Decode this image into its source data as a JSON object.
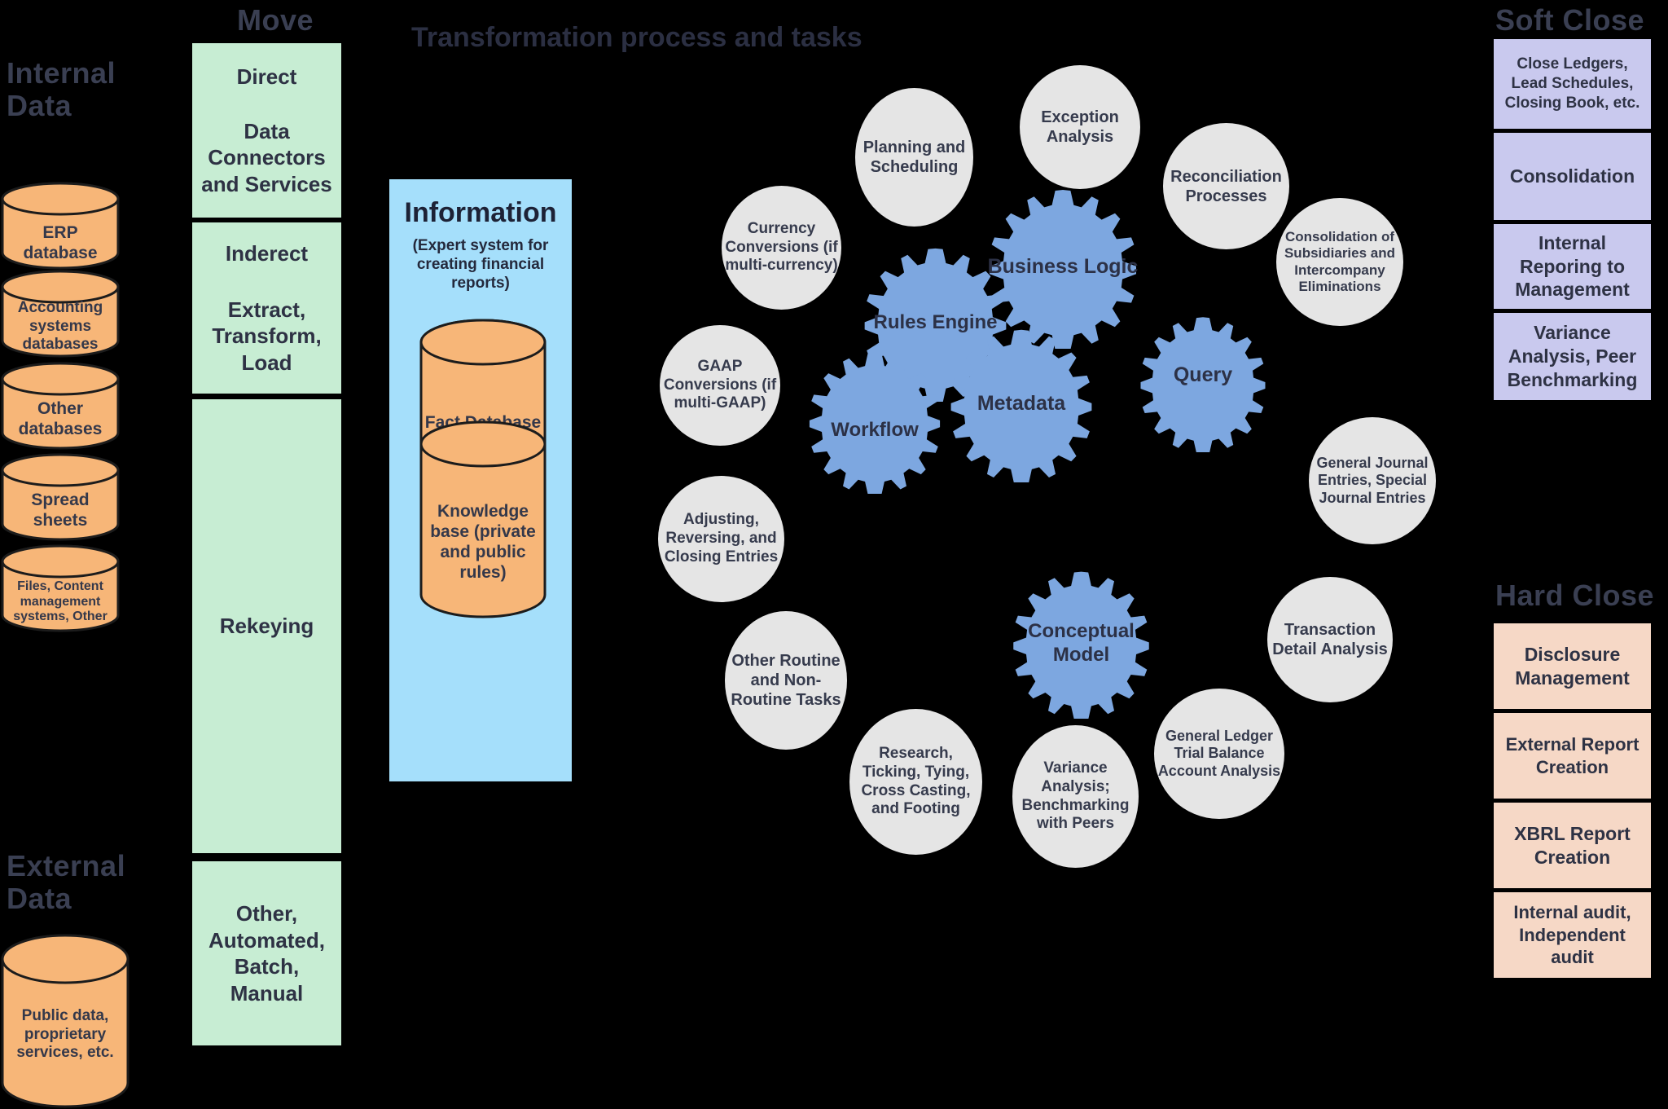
{
  "title": "Transformation process and tasks",
  "colors": {
    "background": "#000000",
    "database_fill": "#f7b678",
    "move_box": "#c7edd3",
    "information_panel": "#a5dffb",
    "gear": "#7da7e0",
    "task_circle": "#e5e5e5",
    "soft_close_box": "#c9c9ee",
    "hard_close_box": "#f6d8c6",
    "heading_text": "#3a3f52"
  },
  "columns": {
    "internal_data": {
      "heading": "Internal Data",
      "items": [
        {
          "label": "ERP database"
        },
        {
          "label": "Accounting systems databases"
        },
        {
          "label": "Other databases"
        },
        {
          "label": "Spread sheets"
        },
        {
          "label": "Files, Content management systems, Other"
        }
      ]
    },
    "external_data": {
      "heading": "External Data",
      "items": [
        {
          "label": "Public data, proprietary services, etc."
        }
      ]
    },
    "move": {
      "heading": "Move",
      "items": [
        {
          "title": "Direct",
          "detail": "Data Connectors and Services"
        },
        {
          "title": "Inderect",
          "detail": "Extract, Transform, Load"
        },
        {
          "title": "",
          "detail": "Rekeying"
        },
        {
          "title": "",
          "detail": "Other, Automated, Batch, Manual"
        }
      ]
    },
    "soft_close": {
      "heading": "Soft Close",
      "items": [
        {
          "label": "Close Ledgers, Lead Schedules, Closing Book, etc."
        },
        {
          "label": "Consolidation"
        },
        {
          "label": "Internal Reporing to Management"
        },
        {
          "label": "Variance Analysis, Peer Benchmarking"
        }
      ]
    },
    "hard_close": {
      "heading": "Hard Close",
      "items": [
        {
          "label": "Disclosure Management"
        },
        {
          "label": "External Report Creation"
        },
        {
          "label": "XBRL Report Creation"
        },
        {
          "label": "Internal audit, Independent audit"
        }
      ]
    }
  },
  "information": {
    "title": "Information",
    "subtitle": "(Expert system for creating financial reports)",
    "databases": [
      {
        "label": "Fact Database"
      },
      {
        "label": "Knowledge base (private and public rules)"
      }
    ]
  },
  "engine": {
    "gears": [
      {
        "label": "Rules Engine"
      },
      {
        "label": "Business Logic"
      },
      {
        "label": "Workflow"
      },
      {
        "label": "Metadata"
      },
      {
        "label": "Query"
      },
      {
        "label": "Conceptual Model"
      }
    ]
  },
  "tasks": [
    {
      "label": "Planning and Scheduling"
    },
    {
      "label": "Exception Analysis"
    },
    {
      "label": "Reconciliation Processes"
    },
    {
      "label": "Currency Conversions (if multi-currency)"
    },
    {
      "label": "Consolidation of Subsidiaries and Intercompany Eliminations"
    },
    {
      "label": "GAAP Conversions (if multi-GAAP)"
    },
    {
      "label": "General Journal Entries, Special Journal Entries"
    },
    {
      "label": "Adjusting, Reversing, and Closing Entries"
    },
    {
      "label": "Transaction Detail Analysis"
    },
    {
      "label": "Other Routine and Non-Routine Tasks"
    },
    {
      "label": "Research, Ticking, Tying, Cross Casting, and Footing"
    },
    {
      "label": "General Ledger Trial Balance Account Analysis"
    },
    {
      "label": "Variance Analysis; Benchmarking with Peers"
    }
  ]
}
